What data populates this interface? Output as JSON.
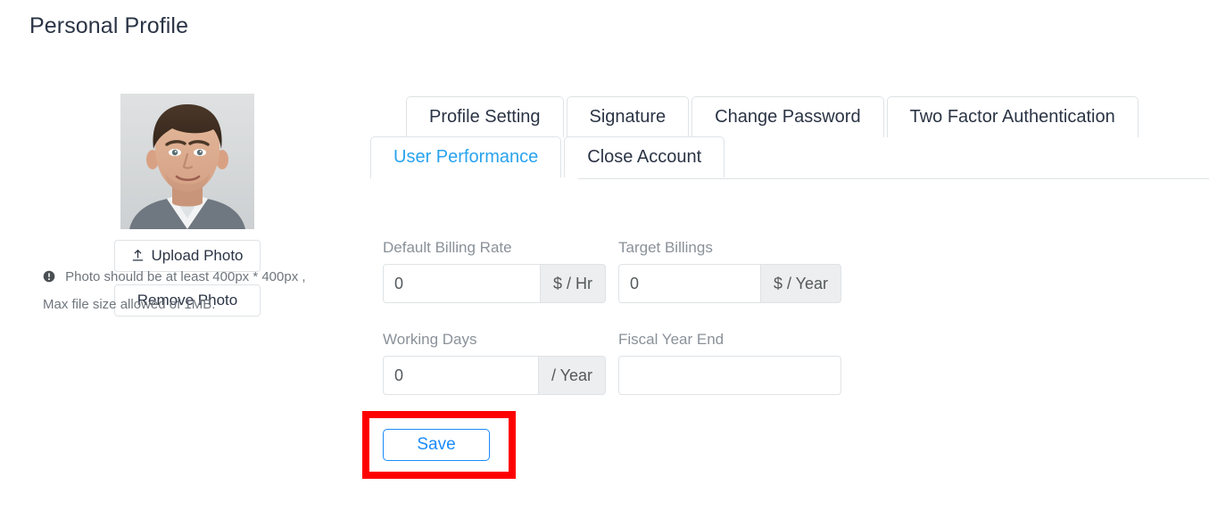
{
  "page": {
    "title": "Personal Profile"
  },
  "profile_photo": {
    "alt": "user-avatar-photo",
    "upload_button": "Upload Photo",
    "upload_icon": "upload-icon",
    "remove_button": "Remove Photo",
    "info_icon": "info-circle-icon",
    "note_line_1": "Photo should be at least 400px * 400px ,",
    "note_line_2": "Max file size allowed of 1MB."
  },
  "tabs": {
    "row1": [
      {
        "label": "Profile Setting",
        "active": false
      },
      {
        "label": "Signature",
        "active": false
      },
      {
        "label": "Change Password",
        "active": false
      },
      {
        "label": "Two Factor Authentication",
        "active": false
      }
    ],
    "row2": [
      {
        "label": "User Performance",
        "active": true
      },
      {
        "label": "Close Account",
        "active": false
      }
    ],
    "active_tab": "User Performance",
    "active_color": "#29a3ef"
  },
  "form": {
    "fields": [
      {
        "label": "Default Billing Rate",
        "value": "0",
        "placeholder": "",
        "addon": "$ / Hr"
      },
      {
        "label": "Target Billings",
        "value": "0",
        "placeholder": "",
        "addon": "$ / Year"
      },
      {
        "label": "Working Days",
        "value": "0",
        "placeholder": "",
        "addon": "/ Year"
      },
      {
        "label": "Fiscal Year End",
        "value": "",
        "placeholder": "",
        "addon": ""
      }
    ],
    "save_label": "Save",
    "save_color": "#1b8bf9"
  },
  "annotation": {
    "highlight_color": "#fe0000",
    "target": "Save"
  }
}
